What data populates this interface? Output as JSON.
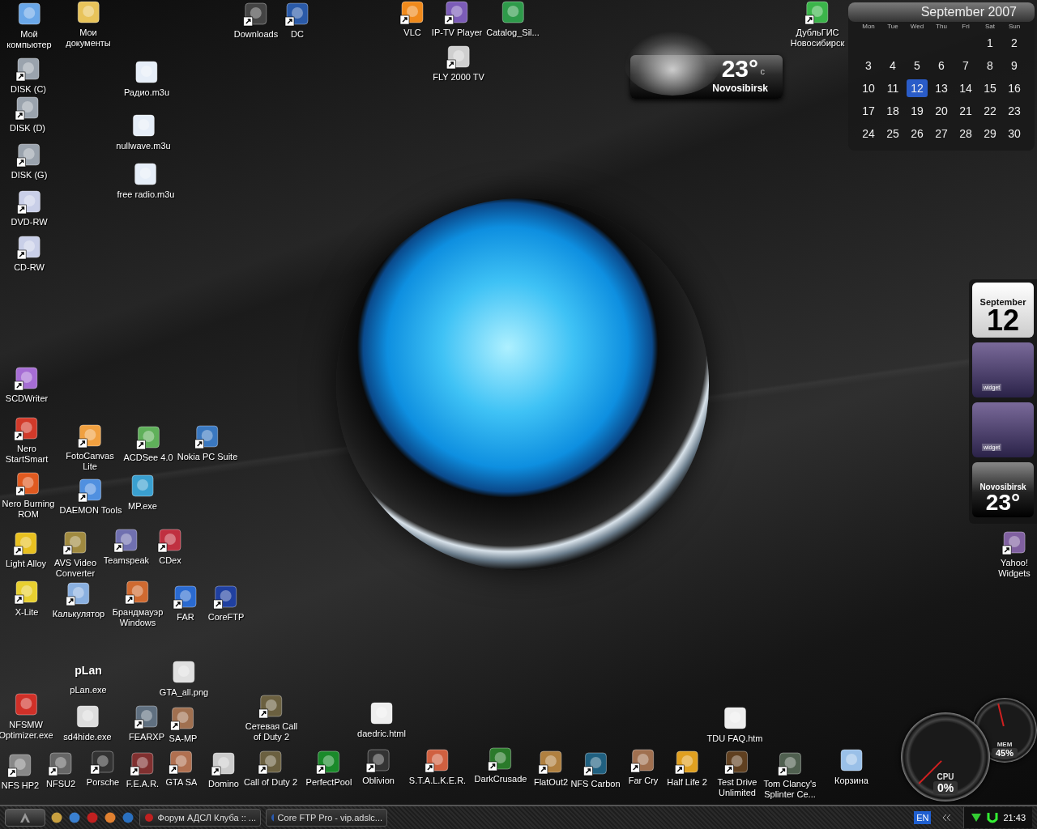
{
  "desktop_icons": [
    {
      "label": "Мой\nкомпьютер",
      "shortcut": false
    },
    {
      "label": "Мои\nдокументы",
      "shortcut": false
    },
    {
      "label": "DISK (C)",
      "shortcut": true
    },
    {
      "label": "DISK (D)",
      "shortcut": true
    },
    {
      "label": "DISK (G)",
      "shortcut": true
    },
    {
      "label": "DVD-RW",
      "shortcut": true
    },
    {
      "label": "CD-RW",
      "shortcut": true
    },
    {
      "label": "Радио.m3u",
      "shortcut": false
    },
    {
      "label": "nullwave.m3u",
      "shortcut": false
    },
    {
      "label": "free radio.m3u",
      "shortcut": false
    },
    {
      "label": "Downloads",
      "shortcut": true
    },
    {
      "label": "DC",
      "shortcut": true
    },
    {
      "label": "VLC",
      "shortcut": true
    },
    {
      "label": "IP-TV Player",
      "shortcut": true
    },
    {
      "label": "Catalog_Sil...",
      "shortcut": false
    },
    {
      "label": "FLY 2000 TV",
      "shortcut": true
    },
    {
      "label": "ДубльГИС\nНовосибирск",
      "shortcut": true
    },
    {
      "label": "SCDWriter",
      "shortcut": true
    },
    {
      "label": "Nero\nStartSmart",
      "shortcut": true
    },
    {
      "label": "FotoCanvas\nLite",
      "shortcut": true
    },
    {
      "label": "ACDSee 4.0",
      "shortcut": true
    },
    {
      "label": "Nokia PC Suite",
      "shortcut": true
    },
    {
      "label": "Nero Burning\nROM",
      "shortcut": true
    },
    {
      "label": "DAEMON Tools",
      "shortcut": true
    },
    {
      "label": "MP.exe",
      "shortcut": false
    },
    {
      "label": "Light Alloy",
      "shortcut": true
    },
    {
      "label": "AVS Video\nConverter",
      "shortcut": true
    },
    {
      "label": "Teamspeak",
      "shortcut": true
    },
    {
      "label": "CDex",
      "shortcut": true
    },
    {
      "label": "X-Lite",
      "shortcut": true
    },
    {
      "label": "Калькулятор",
      "shortcut": true
    },
    {
      "label": "Брандмауэр\nWindows",
      "shortcut": true
    },
    {
      "label": "FAR",
      "shortcut": true
    },
    {
      "label": "CoreFTP",
      "shortcut": true
    },
    {
      "label": "pLan.exe",
      "shortcut": false,
      "icon_text": "pLan"
    },
    {
      "label": "GTA_all.png",
      "shortcut": false
    },
    {
      "label": "NFSMW\nOptimizer.exe",
      "shortcut": false
    },
    {
      "label": "sd4hide.exe",
      "shortcut": false
    },
    {
      "label": "FEARXP",
      "shortcut": true
    },
    {
      "label": "SA-MP",
      "shortcut": true
    },
    {
      "label": "Сетевая Call\nof Duty 2",
      "shortcut": true
    },
    {
      "label": "daedric.html",
      "shortcut": false
    },
    {
      "label": "TDU FAQ.htm",
      "shortcut": false
    },
    {
      "label": "NFS HP2",
      "shortcut": true
    },
    {
      "label": "NFSU2",
      "shortcut": true
    },
    {
      "label": "Porsche",
      "shortcut": true
    },
    {
      "label": "F.E.A.R.",
      "shortcut": true
    },
    {
      "label": "GTA SA",
      "shortcut": true
    },
    {
      "label": "Domino",
      "shortcut": true
    },
    {
      "label": "Call of Duty 2",
      "shortcut": true
    },
    {
      "label": "PerfectPool",
      "shortcut": true
    },
    {
      "label": "Oblivion",
      "shortcut": true
    },
    {
      "label": "S.T.A.L.K.E.R.",
      "shortcut": true
    },
    {
      "label": "DarkCrusade",
      "shortcut": true
    },
    {
      "label": "FlatOut2",
      "shortcut": true
    },
    {
      "label": "NFS Carbon",
      "shortcut": true
    },
    {
      "label": "Far Cry",
      "shortcut": true
    },
    {
      "label": "Half Life 2",
      "shortcut": true
    },
    {
      "label": "Test Drive\nUnlimited",
      "shortcut": true
    },
    {
      "label": "Tom Clancy's\nSplinter Ce...",
      "shortcut": true
    },
    {
      "label": "Корзина",
      "shortcut": false
    },
    {
      "label": "Yahoo!\nWidgets",
      "shortcut": true
    }
  ],
  "weather": {
    "temperature": "23°",
    "unit": "c",
    "city": "Novosibirsk"
  },
  "calendar": {
    "title": "September 2007",
    "weekdays": [
      "Mon",
      "Tue",
      "Wed",
      "Thu",
      "Fri",
      "Sat",
      "Sun"
    ],
    "weeks": [
      [
        {
          "day": "1",
          "selected": false
        },
        {
          "day": "2",
          "selected": false
        }
      ],
      [
        {
          "day": "3",
          "selected": false
        },
        {
          "day": "4",
          "selected": false
        },
        {
          "day": "5",
          "selected": false
        },
        {
          "day": "6",
          "selected": false
        },
        {
          "day": "7",
          "selected": false
        },
        {
          "day": "8",
          "selected": false
        },
        {
          "day": "9",
          "selected": false
        }
      ],
      [
        {
          "day": "10",
          "selected": false
        },
        {
          "day": "11",
          "selected": false
        },
        {
          "day": "12",
          "selected": true
        },
        {
          "day": "13",
          "selected": false
        },
        {
          "day": "14",
          "selected": false
        },
        {
          "day": "15",
          "selected": false
        },
        {
          "day": "16",
          "selected": false
        }
      ],
      [
        {
          "day": "17",
          "selected": false
        },
        {
          "day": "18",
          "selected": false
        },
        {
          "day": "19",
          "selected": false
        },
        {
          "day": "20",
          "selected": false
        },
        {
          "day": "21",
          "selected": false
        },
        {
          "day": "22",
          "selected": false
        },
        {
          "day": "23",
          "selected": false
        }
      ],
      [
        {
          "day": "24",
          "selected": false
        },
        {
          "day": "25",
          "selected": false
        },
        {
          "day": "26",
          "selected": false
        },
        {
          "day": "27",
          "selected": false
        },
        {
          "day": "28",
          "selected": false
        },
        {
          "day": "29",
          "selected": false
        },
        {
          "day": "30",
          "selected": false
        }
      ]
    ]
  },
  "widget_dock": [
    {
      "kind": "calendar",
      "month": "September",
      "day": "12"
    },
    {
      "kind": "widget",
      "label": "widget"
    },
    {
      "kind": "widget",
      "label": "widget"
    },
    {
      "kind": "weather",
      "city": "Novosibirsk",
      "temperature": "23°"
    }
  ],
  "gauges": [
    {
      "label": "CPU",
      "reading": "0%"
    },
    {
      "label": "MEM",
      "reading": "45%"
    }
  ],
  "taskbar": {
    "tasks": [
      {
        "title": "Форум АДСЛ Клуба :: ..."
      },
      {
        "title": "Core FTP Pro - vip.adslc..."
      }
    ],
    "language": "EN",
    "clock": "21:43"
  }
}
